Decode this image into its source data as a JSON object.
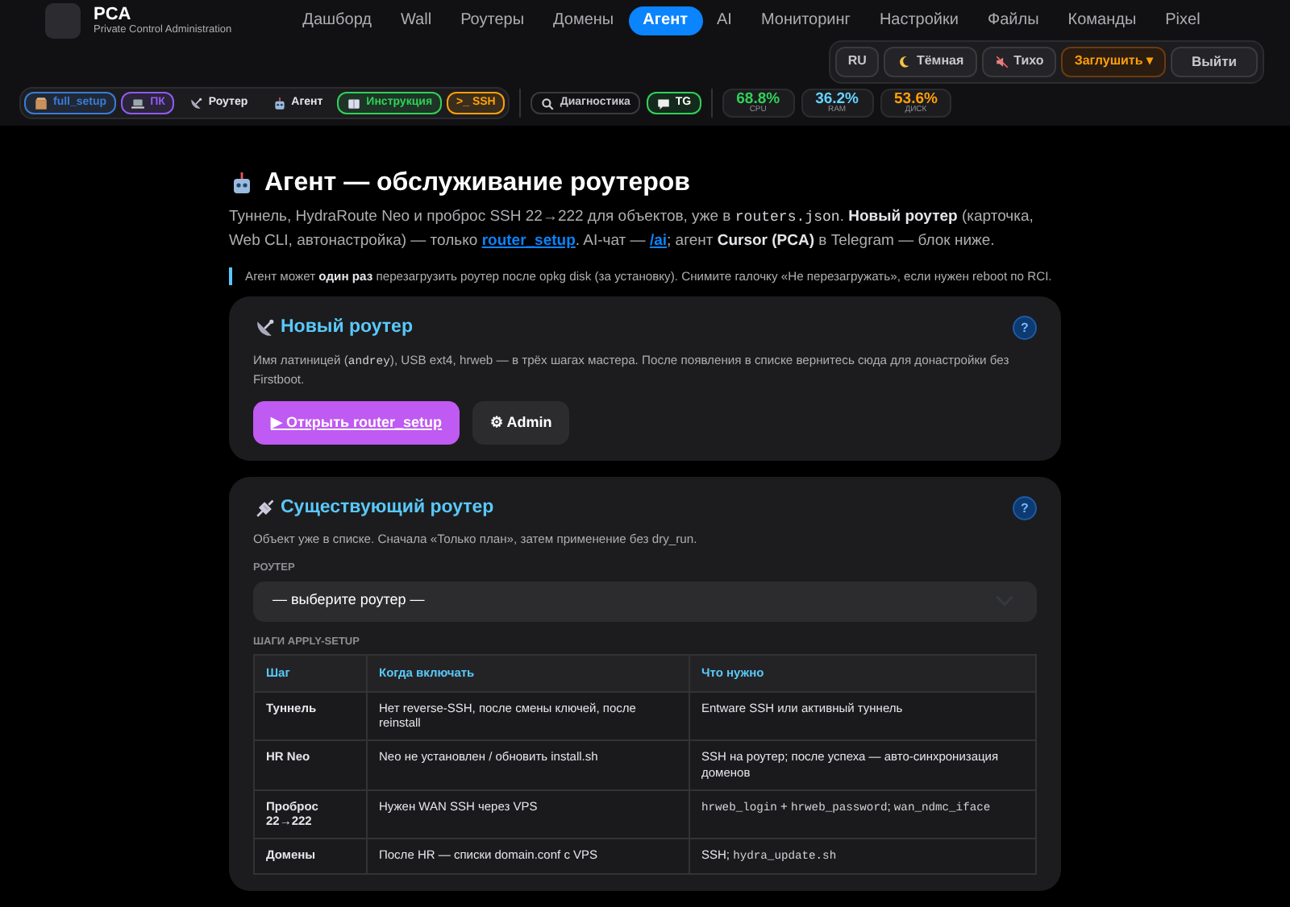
{
  "brand": {
    "title": "PCA",
    "subtitle": "Private Control Administration"
  },
  "nav": [
    {
      "label": "Дашборд",
      "selected": false
    },
    {
      "label": "Wall",
      "selected": false
    },
    {
      "label": "Роутеры",
      "selected": false
    },
    {
      "label": "Домены",
      "selected": false
    },
    {
      "label": "Агент",
      "selected": true
    },
    {
      "label": "AI",
      "selected": false
    },
    {
      "label": "Мониторинг",
      "selected": false
    },
    {
      "label": "Настройки",
      "selected": false
    },
    {
      "label": "Файлы",
      "selected": false
    },
    {
      "label": "Команды",
      "selected": false
    },
    {
      "label": "Pixel",
      "selected": false
    }
  ],
  "header_buttons": [
    {
      "kind": "plain",
      "label": "RU"
    },
    {
      "kind": "moon",
      "label": "Тёмная"
    },
    {
      "kind": "mute",
      "label": "Тихо"
    },
    {
      "kind": "warn",
      "label": "Заглушить ▾"
    },
    {
      "kind": "logout",
      "label": "Выйти"
    }
  ],
  "toolbar": [
    {
      "label": "full_setup",
      "color": "#3a7bd5"
    },
    {
      "label": "ПК",
      "color": "#8e5cf0"
    },
    {
      "label": "Роутер"
    },
    {
      "label": "Агент"
    },
    {
      "label": "Инструкция",
      "color": "#30d158"
    },
    {
      "label": ">_ SSH",
      "color": "#ff9f0a"
    }
  ],
  "tools": [
    {
      "label": "Диагностика"
    },
    {
      "label": "TG",
      "color": "#30d158"
    }
  ],
  "stats": [
    {
      "value": "68.8%",
      "label": "CPU",
      "color": "#30d158"
    },
    {
      "value": "36.2%",
      "label": "RAM",
      "color": "#64d2ff"
    },
    {
      "value": "53.6%",
      "label": "ДИСК",
      "color": "#ff9f0a"
    }
  ],
  "page": {
    "title": "Агент — обслуживание роутеров",
    "intro": [
      {
        "kind": "text",
        "text": "Туннель, HydraRoute Neo и проброс SSH 22→222 для объектов, уже в "
      },
      {
        "kind": "code",
        "text": "routers.json"
      },
      {
        "kind": "text",
        "text": ". "
      },
      {
        "kind": "bold",
        "text": "Новый роутер"
      },
      {
        "kind": "text",
        "text": " (карточка, Web CLI, автонастройка) — только "
      },
      {
        "kind": "link",
        "text": "router_setup"
      },
      {
        "kind": "text",
        "text": ". AI-чат — "
      },
      {
        "kind": "link",
        "text": "/ai"
      },
      {
        "kind": "text",
        "text": "; агент "
      },
      {
        "kind": "bold",
        "text": "Cursor (PCA)"
      },
      {
        "kind": "text",
        "text": " в Telegram — блок ниже."
      }
    ],
    "note": "Агент может **один раз** перезагрузить роутер после opkg disk (за установку). Снимите галочку «Не перезагружать», если нужен reboot по RCI."
  },
  "new_router": {
    "title": "Новый роутер",
    "help": "?",
    "text": [
      {
        "kind": "text",
        "text": "Имя латиницей ("
      },
      {
        "kind": "code",
        "text": "andrey"
      },
      {
        "kind": "text",
        "text": "), USB ext4, hrweb — в трёх шагах мастера. После появления в списке вернитесь сюда для донастройки без Firstboot."
      }
    ],
    "primary_button": "▶ Открыть router_setup",
    "secondary_button": "⚙ Admin"
  },
  "existing_router": {
    "title": "Существующий роутер",
    "help": "?",
    "text": "Объект уже в списке. Сначала «Только план», затем применение без dry_run.",
    "select_label": "РОУТЕР",
    "select_value": "— выберите роутер —",
    "steps_label": "ШАГИ APPLY-SETUP",
    "table": {
      "columns": [
        "Шаг",
        "Когда включать",
        "Что нужно"
      ],
      "rows": [
        [
          "Туннель",
          "Нет reverse-SSH, после смены ключей, после reinstall",
          "Entware SSH или активный туннель"
        ],
        [
          "HR Neo",
          "Neo не установлен / обновить install.sh",
          "SSH на роутер; после успеха — авто-синхронизация доменов"
        ],
        [
          "Проброс 22→222",
          "Нужен WAN SSH через VPS",
          [
            {
              "kind": "code",
              "text": "hrweb_login"
            },
            {
              "kind": "text",
              "text": " + "
            },
            {
              "kind": "code",
              "text": "hrweb_password"
            },
            {
              "kind": "text",
              "text": "; "
            },
            {
              "kind": "code",
              "text": "wan_ndmc_iface"
            }
          ]
        ],
        [
          "Домены",
          "После HR — списки domain.conf с VPS",
          [
            {
              "kind": "text",
              "text": "SSH; "
            },
            {
              "kind": "code",
              "text": "hydra_update.sh"
            }
          ]
        ]
      ]
    }
  }
}
